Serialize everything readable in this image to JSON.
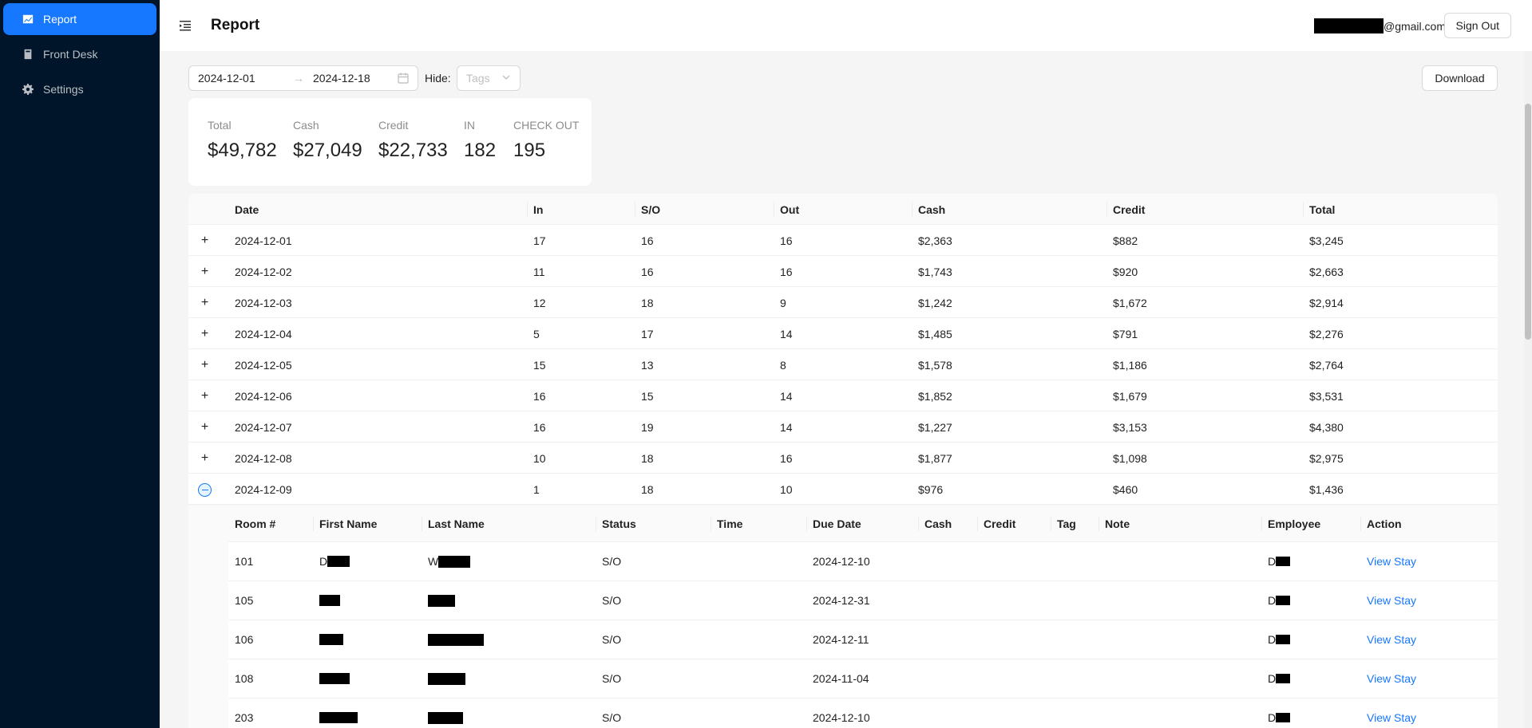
{
  "sidebar": {
    "items": [
      {
        "label": "Report",
        "icon": "chart-icon",
        "active": true
      },
      {
        "label": "Front Desk",
        "icon": "book-icon",
        "active": false
      },
      {
        "label": "Settings",
        "icon": "gear-icon",
        "active": false
      }
    ]
  },
  "header": {
    "title": "Report",
    "email_suffix": "@gmail.com",
    "signout_label": "Sign Out"
  },
  "filters": {
    "start_date": "2024-12-01",
    "end_date": "2024-12-18",
    "arrow": "→",
    "hide_label": "Hide:",
    "tags_placeholder": "Tags",
    "download_label": "Download"
  },
  "stats": [
    {
      "label": "Total",
      "value": "$49,782"
    },
    {
      "label": "Cash",
      "value": "$27,049"
    },
    {
      "label": "Credit",
      "value": "$22,733"
    },
    {
      "label": "IN",
      "value": "182"
    },
    {
      "label": "CHECK OUT",
      "value": "195"
    }
  ],
  "table": {
    "columns": [
      "Date",
      "In",
      "S/O",
      "Out",
      "Cash",
      "Credit",
      "Total"
    ],
    "rows": [
      {
        "date": "2024-12-01",
        "in": "17",
        "so": "16",
        "out": "16",
        "cash": "$2,363",
        "credit": "$882",
        "total": "$3,245"
      },
      {
        "date": "2024-12-02",
        "in": "11",
        "so": "16",
        "out": "16",
        "cash": "$1,743",
        "credit": "$920",
        "total": "$2,663"
      },
      {
        "date": "2024-12-03",
        "in": "12",
        "so": "18",
        "out": "9",
        "cash": "$1,242",
        "credit": "$1,672",
        "total": "$2,914"
      },
      {
        "date": "2024-12-04",
        "in": "5",
        "so": "17",
        "out": "14",
        "cash": "$1,485",
        "credit": "$791",
        "total": "$2,276"
      },
      {
        "date": "2024-12-05",
        "in": "15",
        "so": "13",
        "out": "8",
        "cash": "$1,578",
        "credit": "$1,186",
        "total": "$2,764"
      },
      {
        "date": "2024-12-06",
        "in": "16",
        "so": "15",
        "out": "14",
        "cash": "$1,852",
        "credit": "$1,679",
        "total": "$3,531"
      },
      {
        "date": "2024-12-07",
        "in": "16",
        "so": "19",
        "out": "14",
        "cash": "$1,227",
        "credit": "$3,153",
        "total": "$4,380"
      },
      {
        "date": "2024-12-08",
        "in": "10",
        "so": "18",
        "out": "16",
        "cash": "$1,877",
        "credit": "$1,098",
        "total": "$2,975"
      },
      {
        "date": "2024-12-09",
        "in": "1",
        "so": "18",
        "out": "10",
        "cash": "$976",
        "credit": "$460",
        "total": "$1,436"
      }
    ]
  },
  "nested": {
    "columns": [
      "Room #",
      "First Name",
      "Last Name",
      "Status",
      "Time",
      "Due Date",
      "Cash",
      "Credit",
      "Tag",
      "Note",
      "Employee",
      "Action"
    ],
    "rows": [
      {
        "room": "101",
        "first_prefix": "D",
        "last_prefix": "W",
        "status": "S/O",
        "due": "2024-12-10",
        "emp_prefix": "D",
        "action": "View Stay"
      },
      {
        "room": "105",
        "first_prefix": "",
        "last_prefix": "",
        "status": "S/O",
        "due": "2024-12-31",
        "emp_prefix": "D",
        "action": "View Stay"
      },
      {
        "room": "106",
        "first_prefix": "",
        "last_prefix": "",
        "status": "S/O",
        "due": "2024-12-11",
        "emp_prefix": "D",
        "action": "View Stay"
      },
      {
        "room": "108",
        "first_prefix": "",
        "last_prefix": "",
        "status": "S/O",
        "due": "2024-11-04",
        "emp_prefix": "D",
        "action": "View Stay"
      },
      {
        "room": "203",
        "first_prefix": "",
        "last_prefix": "",
        "status": "S/O",
        "due": "2024-12-10",
        "emp_prefix": "D",
        "action": "View Stay"
      }
    ]
  },
  "expanders": {
    "plus": "+"
  },
  "colors": {
    "accent": "#1677ff",
    "sidebar_bg": "#001529"
  }
}
